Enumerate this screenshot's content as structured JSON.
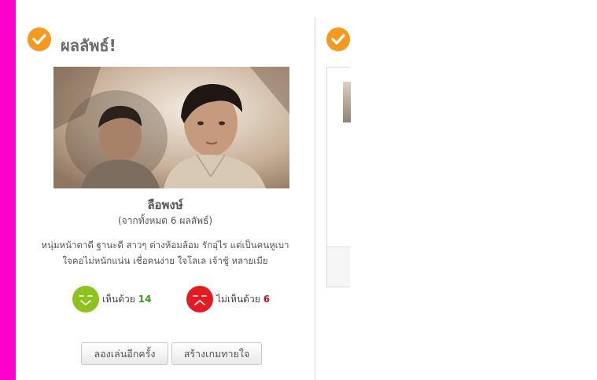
{
  "result": {
    "title": "ผลลัพธ์!",
    "name": "ลือพงษ์",
    "subtitle": "(จากทั้งหมด 6 ผลลัพธ์)",
    "description_line1": "หนุ่มหน้าตาดี ฐานะดี สาวๆ ต่างห้อมล้อม รักอุ่ไร แต่เป็นคนหูเบา",
    "description_line2": "ใจคอไม่หนักแน่น เชื่อคนง่าย ใจโลเล เจ้าชู้ หลายเมีย"
  },
  "votes": {
    "agree_label": "เห็นด้วย",
    "agree_count": "14",
    "disagree_label": "ไม่เห็นด้วย",
    "disagree_count": "6"
  },
  "buttons": {
    "play_again": "ลองเล่นอีกครั้ง",
    "create_game": "สร้างเกมทายใจ"
  },
  "colors": {
    "accent_strip": "#ff00cc",
    "check_badge": "#f39a1f",
    "agree": "#8dc21f",
    "disagree": "#e31b23"
  },
  "icons": {
    "check": "check-circle-icon",
    "agree_face": "smile-face-icon",
    "disagree_face": "frown-face-icon"
  }
}
